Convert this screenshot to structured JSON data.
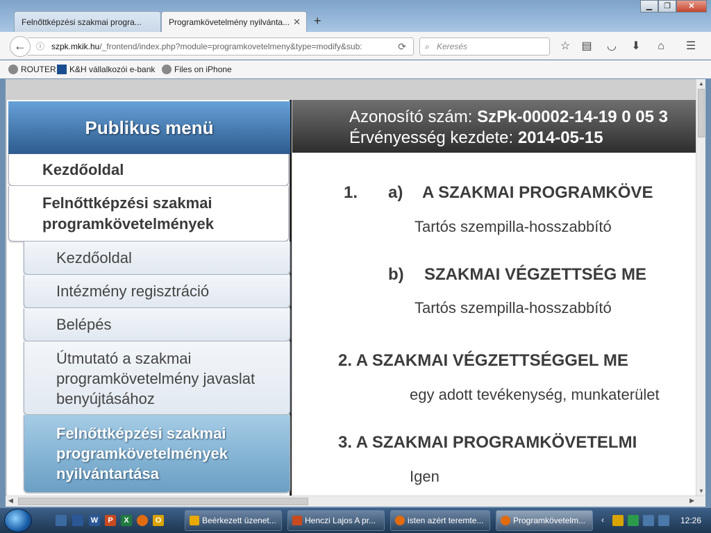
{
  "browser": {
    "tabs": [
      {
        "label": "Felnőttképzési szakmai progra..."
      },
      {
        "label": "Programkövetelmény nyilvánta..."
      }
    ],
    "new_tab": "+",
    "window_buttons": {
      "min": "▁",
      "max": "❐",
      "close": "✕"
    },
    "url": {
      "host": "szpk.mkik.hu",
      "path": "/_frontend/index.php?module=programkovetelmeny&type=modify&sub:",
      "prefix": "szpk."
    },
    "search_placeholder": "Keresés",
    "bookmarks": [
      {
        "label": "ROUTER"
      },
      {
        "label": "K&H vállalkozói e-bank"
      },
      {
        "label": "Files on iPhone"
      }
    ]
  },
  "sidebar": {
    "title": "Publikus menü",
    "items": [
      {
        "label": "Kezdőoldal"
      },
      {
        "label": "Felnőttképzési szakmai programkövetelmények"
      }
    ],
    "subitems": [
      {
        "label": "Kezdőoldal"
      },
      {
        "label": "Intézmény regisztráció"
      },
      {
        "label": "Belépés"
      },
      {
        "label": "Útmutató a szakmai programkövetelmény javaslat benyújtásához"
      },
      {
        "label": "Felnőttképzési szakmai programkövetelmények nyilvántartása"
      }
    ]
  },
  "content": {
    "header": {
      "id_label": "Azonosító szám:",
      "id_value": "SzPk-00002-14-19 0 05 3",
      "date_label": "Érvényesség kezdete:",
      "date_value": "2014-05-15"
    },
    "sections": {
      "s1_num": "1.",
      "s1a_label": "a)",
      "s1a_title": "A SZAKMAI PROGRAMKÖVE",
      "s1a_text": "Tartós szempilla-hosszabbító",
      "s1b_label": "b)",
      "s1b_title": "SZAKMAI VÉGZETTSÉG ME",
      "s1b_text": "Tartós szempilla-hosszabbító",
      "s2_title": "2. A SZAKMAI VÉGZETTSÉGGEL ME",
      "s2_text": "egy adott tevékenység, munkaterület",
      "s3_title": "3. A SZAKMAI PROGRAMKÖVETELMI",
      "s3_text": "Igen"
    }
  },
  "taskbar": {
    "buttons": [
      {
        "label": "Beérkezett üzenet..."
      },
      {
        "label": "Henczi Lajos A pr..."
      },
      {
        "label": "isten azért teremte..."
      },
      {
        "label": "Programkövetelm..."
      }
    ],
    "clock": "12:26"
  }
}
